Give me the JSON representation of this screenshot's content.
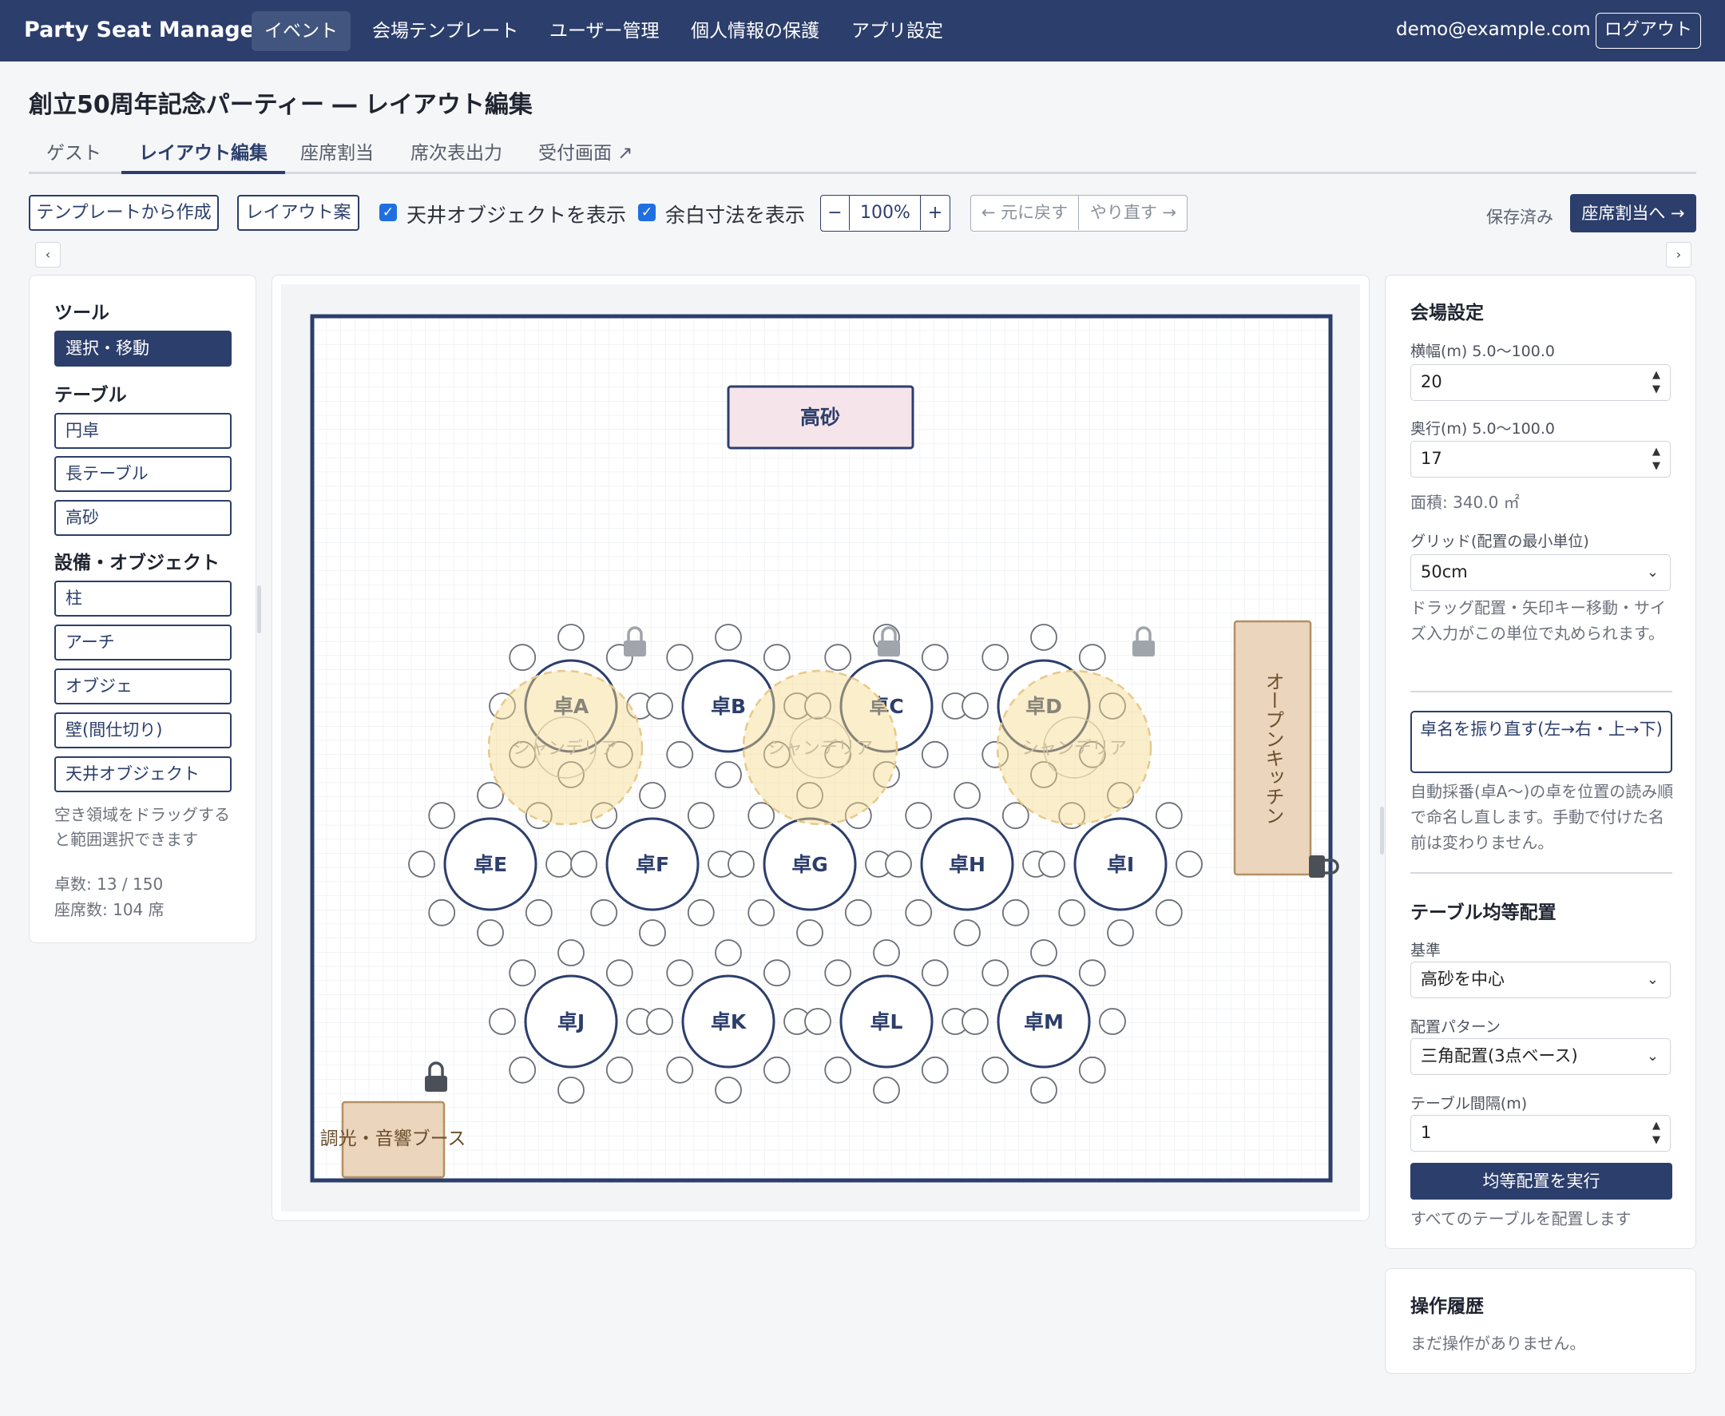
{
  "nav": {
    "brand": "Party Seat Manager",
    "items": [
      "イベント",
      "会場テンプレート",
      "ユーザー管理",
      "個人情報の保護",
      "アプリ設定"
    ],
    "email": "demo@example.com",
    "logout": "ログアウト"
  },
  "page": {
    "title": "創立50周年記念パーティー ― レイアウト編集"
  },
  "tabs": [
    "ゲスト",
    "レイアウト編集",
    "座席割当",
    "席次表出力",
    "受付画面 ↗"
  ],
  "toolbar": {
    "from_template": "テンプレートから作成",
    "layout_plan": "レイアウト案",
    "show_ceiling": "天井オブジェクトを表示",
    "show_margin": "余白寸法を表示",
    "zoom_minus": "−",
    "zoom_value": "100%",
    "zoom_plus": "+",
    "undo": "← 元に戻す",
    "redo": "やり直す →",
    "saved": "保存済み",
    "to_assign": "座席割当へ →",
    "collapse_left": "‹",
    "collapse_right": "›"
  },
  "left": {
    "tools_title": "ツール",
    "tool_select": "選択・移動",
    "tables_title": "テーブル",
    "tables": [
      "円卓",
      "長テーブル",
      "高砂"
    ],
    "equip_title": "設備・オブジェクト",
    "equip": [
      "柱",
      "アーチ",
      "オブジェ",
      "壁(間仕切り)",
      "天井オブジェクト"
    ],
    "hint": "空き領域をドラッグすると範囲選択できます",
    "table_count": "卓数: 13 / 150",
    "seat_count": "座席数: 104 席"
  },
  "canvas": {
    "stage": "高砂",
    "kitchen": "オープンキッチン",
    "booth": "調光・音響ブース",
    "chandelier": "シャンデリア",
    "tables": [
      "卓A",
      "卓B",
      "卓C",
      "卓D",
      "卓E",
      "卓F",
      "卓G",
      "卓H",
      "卓I",
      "卓J",
      "卓K",
      "卓L",
      "卓M"
    ]
  },
  "right": {
    "venue_title": "会場設定",
    "width_label": "横幅(m) 5.0〜100.0",
    "width_value": "20",
    "depth_label": "奥行(m) 5.0〜100.0",
    "depth_value": "17",
    "area": "面積: 340.0 ㎡",
    "grid_label": "グリッド(配置の最小単位)",
    "grid_value": "50cm",
    "grid_hint": "ドラッグ配置・矢印キー移動・サイズ入力がこの単位で丸められます。",
    "rename_button": "卓名を振り直す(左→右・上→下)",
    "rename_hint": "自動採番(卓A〜)の卓を位置の読み順で命名し直します。手動で付けた名前は変わりません。",
    "distribute_title": "テーブル均等配置",
    "basis_label": "基準",
    "basis_value": "高砂を中心",
    "pattern_label": "配置パターン",
    "pattern_value": "三角配置(3点ベース)",
    "spacing_label": "テーブル間隔(m)",
    "spacing_value": "1",
    "run_button": "均等配置を実行",
    "run_hint": "すべてのテーブルを配置します",
    "history_title": "操作履歴",
    "history_empty": "まだ操作がありません。"
  }
}
